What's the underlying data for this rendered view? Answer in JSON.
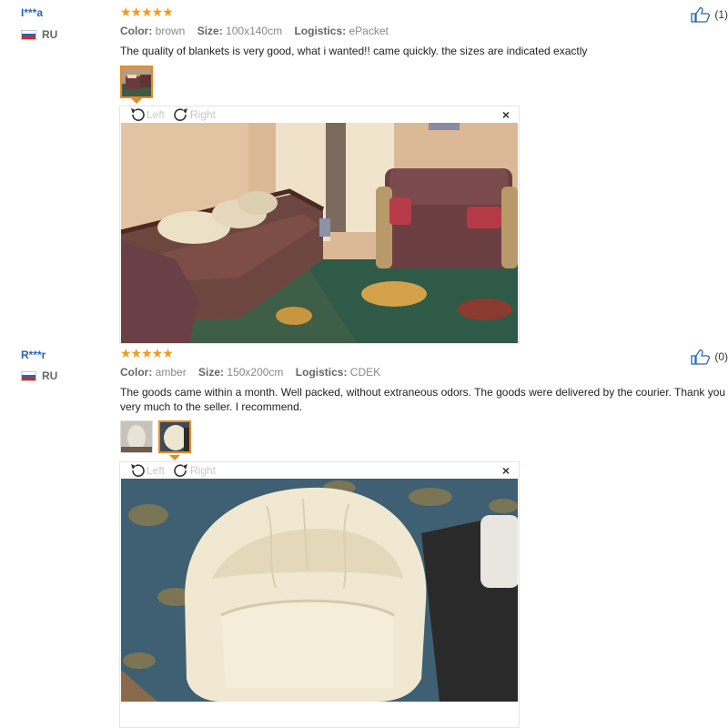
{
  "reviews": [
    {
      "user": "I***a",
      "country": "RU",
      "stars": "★★★★★",
      "color_label": "Color:",
      "color_value": "brown",
      "size_label": "Size:",
      "size_value": "100x140cm",
      "logistics_label": "Logistics:",
      "logistics_value": "ePacket",
      "comment": "The quality of blankets is very good, what i wanted!! came quickly. the sizes are indicated exactly",
      "helpful_count": "(1)",
      "viewer": {
        "rotate_left": "Left",
        "rotate_right": "Right",
        "close": "×"
      }
    },
    {
      "user": "R***r",
      "country": "RU",
      "stars": "★★★★★",
      "color_label": "Color:",
      "color_value": "amber",
      "size_label": "Size:",
      "size_value": "150x200cm",
      "logistics_label": "Logistics:",
      "logistics_value": "CDEK",
      "comment": "The goods came within a month. Well packed, without extraneous odors. The goods were delivered by the courier. Thank you very much to the seller. I recommend.",
      "helpful_count": "(0)",
      "viewer": {
        "rotate_left": "Left",
        "rotate_right": "Right",
        "close": "×"
      }
    }
  ],
  "colors": {
    "username": "#2767b0",
    "star": "#f29b1a",
    "active_thumb_border": "#e88b1e"
  },
  "icons": [
    "thumbs-up-icon",
    "rotate-left-icon",
    "rotate-right-icon",
    "close-icon",
    "russia-flag-icon",
    "star-icon"
  ]
}
